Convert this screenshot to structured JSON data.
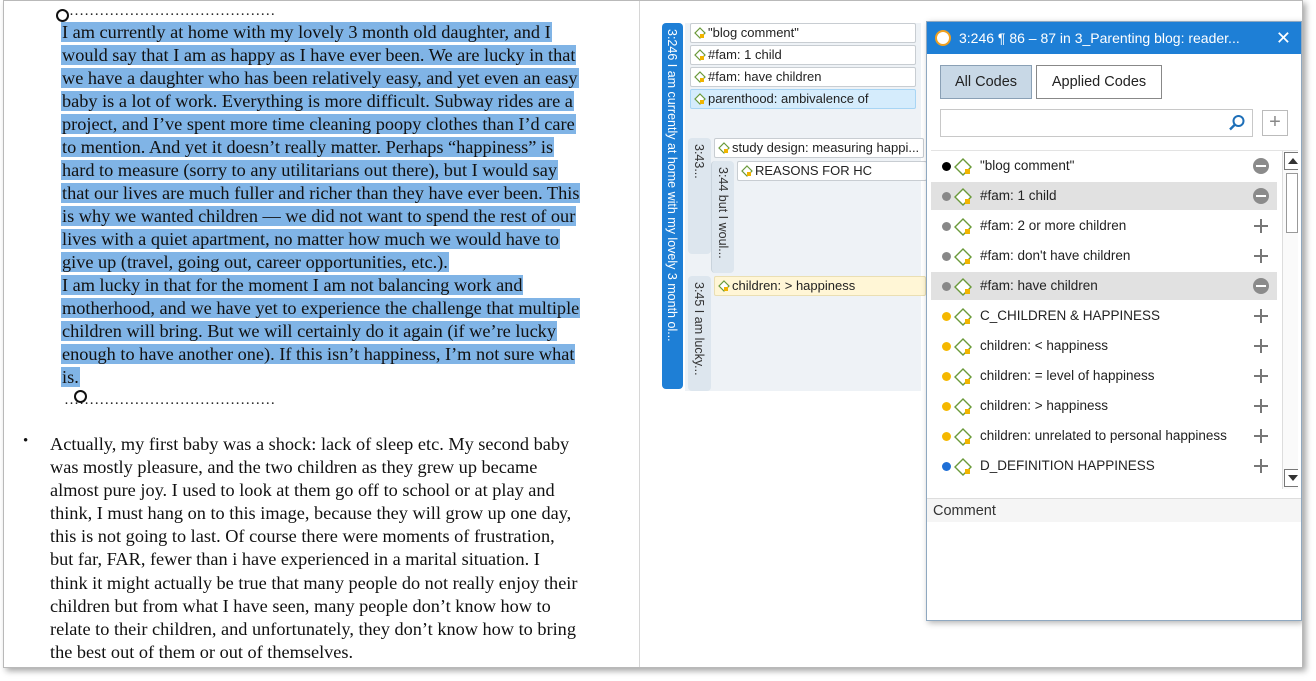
{
  "document": {
    "dots": "……………………………………",
    "selected_lines": [
      "I am currently at home with my lovely 3 month old daughter, and I",
      "would say that I am as happy as I have ever been. We are lucky in that",
      "we have a daughter who has been relatively easy, and yet even an easy",
      "baby is a lot of work. Everything is more difficult. Subway rides are a",
      "project, and I’ve spent more time cleaning poopy clothes than I’d care",
      "to mention. And yet it doesn’t really matter. Perhaps “happiness” is",
      "hard to measure (sorry to any utilitarians out there), but I would say",
      "that our lives are much fuller and richer than they have ever been. This",
      "is why we wanted children — we did not want to spend the rest of our",
      "lives with a quiet apartment, no matter how much we would have to",
      "give up (travel, going out, career opportunities, etc.).",
      "I am lucky in that for the moment I am not balancing work and",
      "motherhood, and we have yet to experience the challenge that multiple",
      "children will bring. But we will certainly do it again (if we’re lucky",
      "enough to have another one). If this isn’t happiness, I’m not sure what",
      "is."
    ],
    "bullet": "•",
    "para2_lines": [
      "Actually, my first baby was a shock: lack of sleep etc. My second baby",
      " was mostly pleasure, and the two children as they grew up became",
      " almost pure joy. I used to look at them go off to school or at play and",
      " think, I must hang on to this image, because they will grow up one day,",
      " this is not going to last. Of course there were moments of frustration,",
      " but far, FAR, fewer than i have experienced in a marital situation. I",
      " think it might actually be true that many people do not really enjoy their",
      " children but from what I have seen, many people don’t know how to",
      " relate to their children, and unfortunately, they don’t know how to bring",
      " the best out of them or out of themselves."
    ]
  },
  "margin": {
    "brackets": {
      "main": "3:246 I am currently at home with my lovely 3 month ol...",
      "b343": "3:43...",
      "b344": "3:44 but I woul...",
      "b345": "3:45 I am lucky..."
    },
    "codes": {
      "c1": "\"blog comment\"",
      "c2": "#fam: 1 child",
      "c3": "#fam: have children",
      "c4": "parenthood: ambivalence of",
      "c5": "study design: measuring happi...",
      "c6": "REASONS FOR HC",
      "c7": "children: > happiness"
    }
  },
  "popup": {
    "title": "3:246 ¶ 86 – 87 in 3_Parenting blog: reader...",
    "close": "✕",
    "tab_all": "All Codes",
    "tab_applied": "Applied Codes",
    "search_placeholder": "",
    "add": "+",
    "comment_label": "Comment",
    "codes": [
      {
        "label": "\"blog comment\"",
        "color": "#000000",
        "applied": true
      },
      {
        "label": "#fam: 1 child",
        "color": "#888888",
        "applied": true
      },
      {
        "label": "#fam: 2 or more  children",
        "color": "#888888",
        "applied": false
      },
      {
        "label": "#fam: don't have children",
        "color": "#888888",
        "applied": false
      },
      {
        "label": "#fam: have children",
        "color": "#888888",
        "applied": true
      },
      {
        "label": "C_CHILDREN & HAPPINESS",
        "color": "#f5b800",
        "applied": false
      },
      {
        "label": "children: < happiness",
        "color": "#f5b800",
        "applied": false
      },
      {
        "label": "children: = level of happiness",
        "color": "#f5b800",
        "applied": false
      },
      {
        "label": "children: > happiness",
        "color": "#f5b800",
        "applied": false
      },
      {
        "label": "children: unrelated to personal happiness",
        "color": "#f5b800",
        "applied": false
      },
      {
        "label": "D_DEFINITION HAPPINESS",
        "color": "#1e6fd6",
        "applied": false
      }
    ]
  },
  "colors": {
    "selection": "#80b4e6",
    "accent": "#1e7fd6"
  }
}
